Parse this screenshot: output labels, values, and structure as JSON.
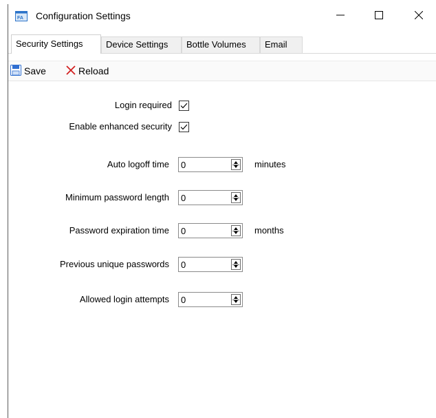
{
  "window": {
    "title": "Configuration Settings",
    "icon": "fa-app-icon",
    "controls": [
      "minimize-icon",
      "maximize-icon",
      "close-icon"
    ]
  },
  "tabs": [
    {
      "label": "Security Settings",
      "active": true
    },
    {
      "label": "Device Settings",
      "active": false
    },
    {
      "label": "Bottle Volumes",
      "active": false
    },
    {
      "label": "Email",
      "active": false
    }
  ],
  "toolbar": {
    "save_label": "Save",
    "save_icon": "floppy-disk-icon",
    "reload_label": "Reload",
    "reload_icon": "x-icon"
  },
  "security": {
    "login_required_label": "Login required",
    "login_required_checked": true,
    "enhanced_security_label": "Enable enhanced security",
    "enhanced_security_checked": true,
    "auto_logoff_label": "Auto logoff time",
    "auto_logoff_value": "0",
    "auto_logoff_unit": "minutes",
    "min_password_label": "Minimum password length",
    "min_password_value": "0",
    "password_expiration_label": "Password expiration time",
    "password_expiration_value": "0",
    "password_expiration_unit": "months",
    "previous_unique_label": "Previous unique passwords",
    "previous_unique_value": "0",
    "login_attempts_label": "Allowed login attempts",
    "login_attempts_value": "0"
  },
  "colors": {
    "save_icon": "#2f6fd1",
    "reload_icon": "#d21f1f",
    "app_icon": "#2b73c9"
  }
}
